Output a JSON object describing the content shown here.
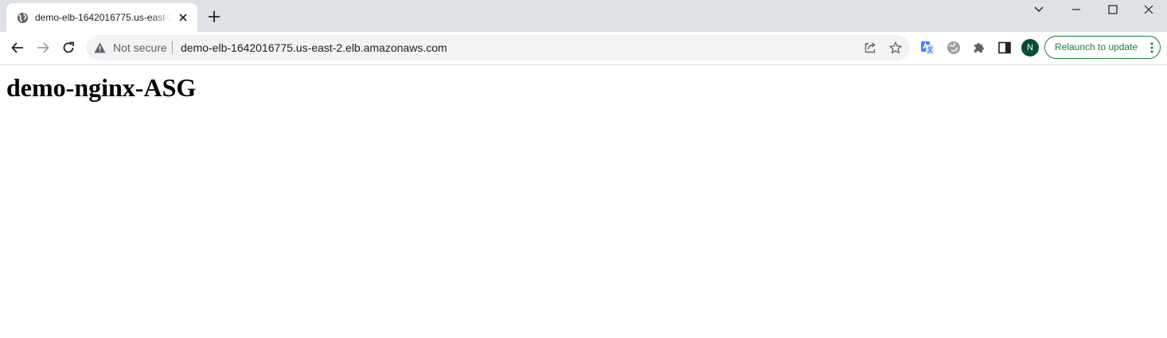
{
  "tab": {
    "title": "demo-elb-1642016775.us-east-2.elb.amazonaws.com",
    "favicon": "globe-icon"
  },
  "window_controls": [
    "chevron-down-icon",
    "minimize-icon",
    "maximize-icon",
    "close-icon"
  ],
  "address_bar": {
    "security_label": "Not secure",
    "url": "demo-elb-1642016775.us-east-2.elb.amazonaws.com"
  },
  "toolbar_icons": [
    "back-arrow-icon",
    "forward-arrow-icon",
    "reload-icon",
    "share-icon",
    "bookmark-star-icon",
    "translate-icon",
    "extension-icon",
    "puzzle-icon",
    "side-panel-icon"
  ],
  "profile": {
    "initial": "N",
    "color": "#0b4a34"
  },
  "relaunch_button": {
    "label": "Relaunch to update",
    "color": "#188038"
  },
  "page": {
    "heading": "demo-nginx-ASG"
  }
}
